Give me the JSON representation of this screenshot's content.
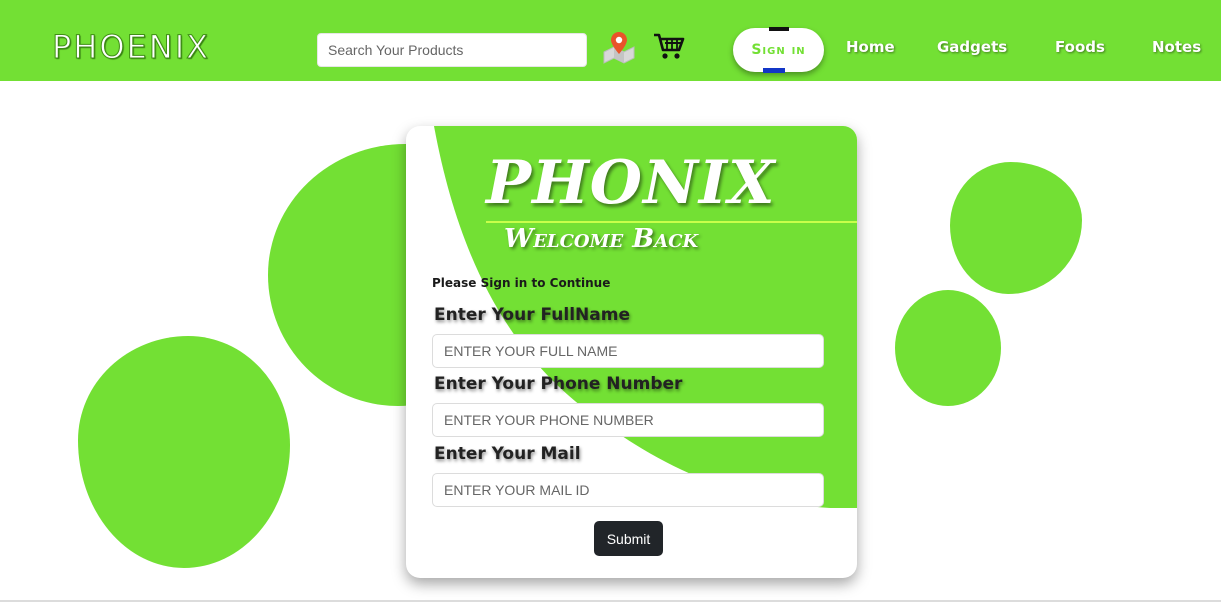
{
  "header": {
    "brand": "PHOENIX",
    "search_placeholder": "Search Your Products",
    "signin_label": "Sign in",
    "nav": [
      "Home",
      "Gadgets",
      "Foods",
      "Notes"
    ]
  },
  "icons": {
    "location": "map-pin-icon",
    "cart": "shopping-cart-icon"
  },
  "card": {
    "title": "PHONIX",
    "subtitle": "Welcome Back",
    "prompt": "Please Sign in to Continue",
    "fields": [
      {
        "label": "Enter Your FullName",
        "placeholder": "ENTER YOUR FULL NAME"
      },
      {
        "label": "Enter Your Phone Number",
        "placeholder": "ENTER YOUR PHONE NUMBER"
      },
      {
        "label": "Enter Your Mail",
        "placeholder": "ENTER YOUR MAIL ID"
      }
    ],
    "submit_label": "Submit"
  },
  "colors": {
    "accent": "#73e034",
    "button_dark": "#212529"
  }
}
